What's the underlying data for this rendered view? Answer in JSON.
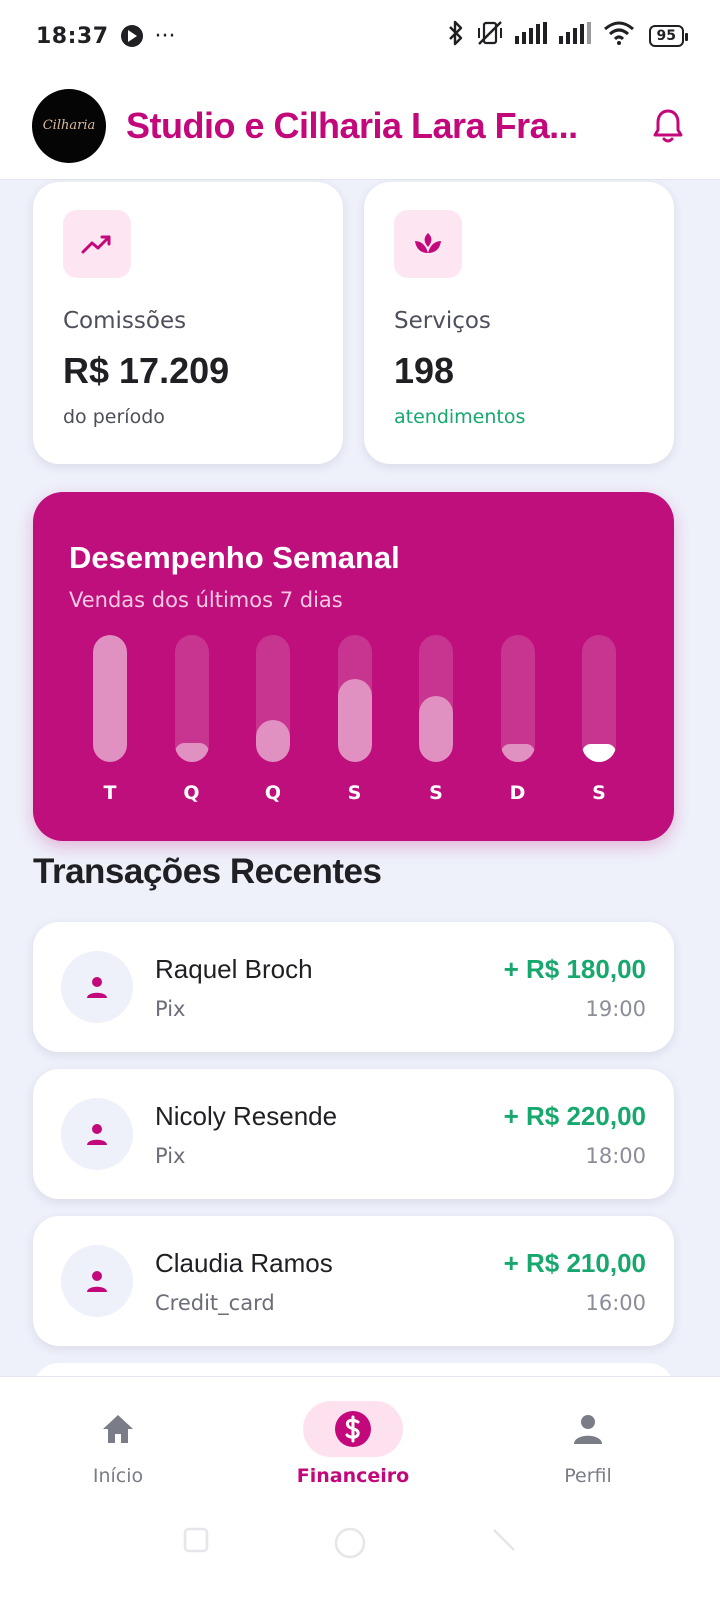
{
  "status_bar": {
    "time": "18:37",
    "more": "···",
    "battery": "95"
  },
  "header": {
    "logo_text": "Cilharia",
    "title": "Studio e Cilharia Lara Fra..."
  },
  "stats": [
    {
      "icon": "trending-up-icon",
      "label": "Comissões",
      "value": "R$ 17.209",
      "sub": "do período",
      "sub_color": "#4d4f5a"
    },
    {
      "icon": "spa-icon",
      "label": "Serviços",
      "value": "198",
      "sub": "atendimentos",
      "sub_color": "#17a86d"
    }
  ],
  "chart": {
    "title": "Desempenho Semanal",
    "subtitle": "Vendas dos últimos 7 dias"
  },
  "chart_data": {
    "type": "bar",
    "title": "Desempenho Semanal",
    "subtitle": "Vendas dos últimos 7 dias",
    "categories": [
      "T",
      "Q",
      "Q",
      "S",
      "S",
      "D",
      "S"
    ],
    "values": [
      1.0,
      0.15,
      0.33,
      0.65,
      0.52,
      0.07,
      0.14
    ],
    "highlight_index": 6,
    "ylim": [
      0,
      1
    ],
    "grid": false
  },
  "transactions": {
    "title": "Transações Recentes",
    "items": [
      {
        "name": "Raquel Broch",
        "method": "Pix",
        "amount": "+ R$ 180,00",
        "time": "19:00"
      },
      {
        "name": "Nicoly Resende",
        "method": "Pix",
        "amount": "+ R$ 220,00",
        "time": "18:00"
      },
      {
        "name": "Claudia Ramos",
        "method": "Credit_card",
        "amount": "+ R$ 210,00",
        "time": "16:00"
      }
    ]
  },
  "bottom_nav": [
    {
      "label": "Início",
      "icon": "home-icon",
      "active": false
    },
    {
      "label": "Financeiro",
      "icon": "dollar-icon",
      "active": true
    },
    {
      "label": "Perfil",
      "icon": "person-icon",
      "active": false
    }
  ],
  "colors": {
    "brand": "#c2087a",
    "chart_bg": "#be0f7d",
    "positive": "#17a86d",
    "background": "#eef0fa"
  }
}
